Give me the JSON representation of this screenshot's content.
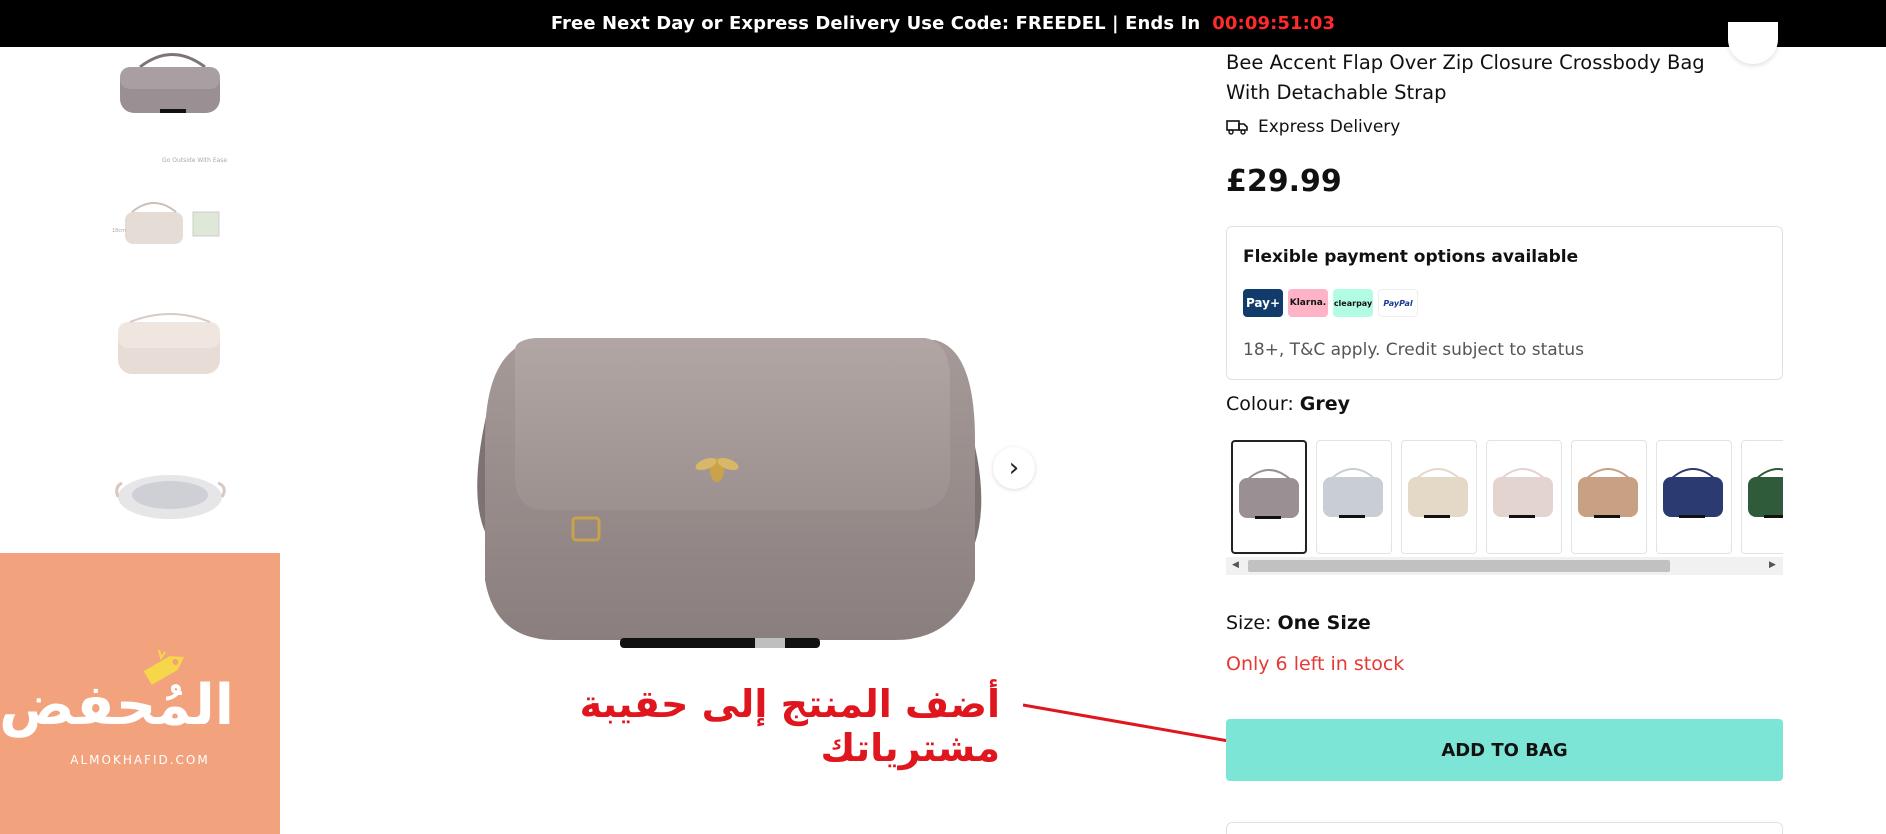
{
  "promo": {
    "text": "Free Next Day or Express Delivery Use Code: FREEDEL | Ends In",
    "timer": "00:09:51:03",
    "timer_color": "#ff2a2a"
  },
  "product": {
    "title": "Bee Accent Flap Over Zip Closure Crossbody Bag With Detachable Strap",
    "delivery_label": "Express Delivery",
    "price": "£29.99"
  },
  "payment": {
    "title": "Flexible payment options available",
    "logos": [
      {
        "name": "payplus-logo",
        "text": "Pay+"
      },
      {
        "name": "klarna-logo",
        "text": "Klarna."
      },
      {
        "name": "clearpay-logo",
        "text": "clearpay"
      },
      {
        "name": "paypal-logo",
        "text": "PayPal"
      }
    ],
    "note": "18+, T&C apply. Credit subject to status"
  },
  "colour": {
    "label": "Colour:",
    "value": "Grey",
    "swatches": [
      {
        "color": "#9a8f92",
        "selected": true
      },
      {
        "color": "#c9cdd6",
        "selected": false
      },
      {
        "color": "#e4d8c6",
        "selected": false
      },
      {
        "color": "#e3d4cf",
        "selected": false
      },
      {
        "color": "#c8a184",
        "selected": false
      },
      {
        "color": "#2b3a70",
        "selected": false
      },
      {
        "color": "#2f5b3a",
        "selected": false
      }
    ]
  },
  "size": {
    "label": "Size:",
    "value": "One Size"
  },
  "stock": {
    "text": "Only 6 left in stock",
    "color": "#e53935"
  },
  "cta": {
    "label": "ADD TO BAG",
    "color": "#7de5d6"
  },
  "annotation": {
    "text": "أضف المنتج إلى حقيبة مشترياتك",
    "color": "#e0161e"
  },
  "logo": {
    "arabic": "المُحفض",
    "latin": "ALMOKHAFID.COM",
    "background": "#f2a27c"
  },
  "icons": {
    "next": "chevron-right-icon",
    "delivery": "truck-icon",
    "wishlist": "heart-icon"
  }
}
